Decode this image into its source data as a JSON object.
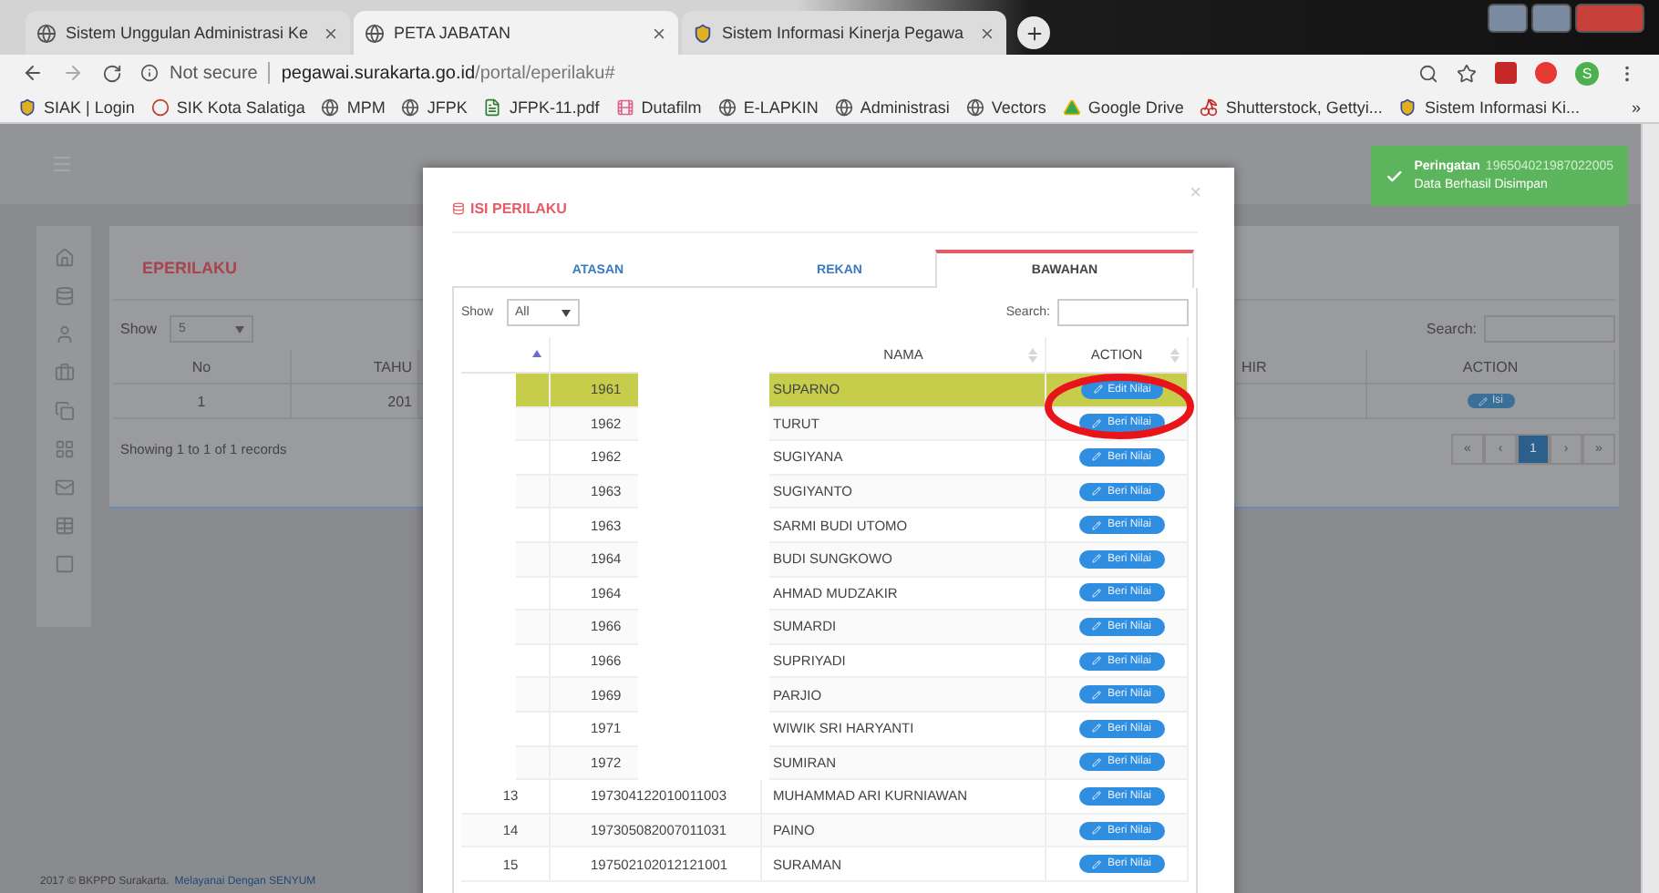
{
  "browser": {
    "tabs": [
      {
        "title": "Sistem Unggulan Administrasi Ke",
        "kind": "globe",
        "selected": false
      },
      {
        "title": "PETA JABATAN",
        "kind": "globe",
        "selected": true
      },
      {
        "title": "Sistem Informasi Kinerja Pegawa",
        "kind": "badge",
        "selected": false
      }
    ],
    "address": {
      "security": "Not secure",
      "host": "pegawai.surakarta.go.id",
      "path": "/portal/eperilaku#"
    },
    "profile_initial": "S",
    "bookmarks": [
      {
        "label": "SIAK | Login",
        "kind": "badge"
      },
      {
        "label": "SIK Kota Salatiga",
        "kind": "web"
      },
      {
        "label": "MPM",
        "kind": "globe"
      },
      {
        "label": "JFPK",
        "kind": "globe"
      },
      {
        "label": "JFPK-11.pdf",
        "kind": "doc"
      },
      {
        "label": "Dutafilm",
        "kind": "film"
      },
      {
        "label": "E-LAPKIN",
        "kind": "globe"
      },
      {
        "label": "Administrasi",
        "kind": "globe"
      },
      {
        "label": "Vectors",
        "kind": "globe"
      },
      {
        "label": "Google Drive",
        "kind": "drive"
      },
      {
        "label": "Shutterstock, Gettyi...",
        "kind": "fruit"
      },
      {
        "label": "Sistem Informasi Ki...",
        "kind": "badge"
      }
    ],
    "bookmarks_more": "»"
  },
  "page": {
    "card": {
      "title": "EPERILAKU",
      "show_label": "Show",
      "page_length": "5",
      "search_label": "Search:",
      "columns": [
        "No",
        "TAHU",
        "HIR",
        "ACTION"
      ],
      "rows": [
        {
          "no": "1",
          "tahun": "201",
          "action": "Isi"
        }
      ],
      "info": "Showing 1 to 1 of 1 records",
      "pagination": [
        {
          "label": "«",
          "selected": false
        },
        {
          "label": "‹",
          "selected": false
        },
        {
          "label": "1",
          "selected": true
        },
        {
          "label": "›",
          "selected": false
        },
        {
          "label": "»",
          "selected": false
        }
      ]
    },
    "footer": {
      "text": "2017 © BKPPD Surakarta.",
      "link": "Melayanai Dengan SENYUM"
    }
  },
  "toast": {
    "title": "Peringatan",
    "detail": "196504021987022005",
    "message": "Data Berhasil Disimpan"
  },
  "modal": {
    "title": "ISI PERILAKU",
    "close": "×",
    "tabs": [
      {
        "label": "ATASAN",
        "selected": false
      },
      {
        "label": "REKAN",
        "selected": false
      },
      {
        "label": "BAWAHAN",
        "selected": true
      }
    ],
    "show_label": "Show",
    "page_length": "All",
    "search_label": "Search:",
    "columns": [
      {
        "sorted": true
      },
      {
        "label": "NAMA",
        "sorted": false
      },
      {
        "label": "ACTION",
        "sorted": false
      }
    ],
    "rows": [
      {
        "nip": "1961",
        "name": "SUPARNO",
        "action": "Edit Nilai",
        "selected": true
      },
      {
        "nip": "1962",
        "name": "TURUT",
        "action": "Beri Nilai",
        "selected": false
      },
      {
        "nip": "1962",
        "name": "SUGIYANA",
        "action": "Beri Nilai",
        "selected": false
      },
      {
        "nip": "1963",
        "name": "SUGIYANTO",
        "action": "Beri Nilai",
        "selected": false
      },
      {
        "nip": "1963",
        "name": "SARMI BUDI UTOMO",
        "action": "Beri Nilai",
        "selected": false
      },
      {
        "nip": "1964",
        "name": "BUDI SUNGKOWO",
        "action": "Beri Nilai",
        "selected": false
      },
      {
        "nip": "1964",
        "name": "AHMAD MUDZAKIR",
        "action": "Beri Nilai",
        "selected": false
      },
      {
        "nip": "1966",
        "name": "SUMARDI",
        "action": "Beri Nilai",
        "selected": false
      },
      {
        "nip": "1966",
        "name": "SUPRIYADI",
        "action": "Beri Nilai",
        "selected": false
      },
      {
        "nip": "1969",
        "name": "PARJIO",
        "action": "Beri Nilai",
        "selected": false
      },
      {
        "nip": "1971",
        "name": "WIWIK SRI HARYANTI",
        "action": "Beri Nilai",
        "selected": false
      },
      {
        "nip": "1972",
        "name": "SUMIRAN",
        "action": "Beri Nilai",
        "selected": false
      },
      {
        "no": "13",
        "nip": "197304122010011003",
        "name": "MUHAMMAD ARI KURNIAWAN",
        "action": "Beri Nilai",
        "selected": false
      },
      {
        "no": "14",
        "nip": "197305082007011031",
        "name": "PAINO",
        "action": "Beri Nilai",
        "selected": false
      },
      {
        "no": "15",
        "nip": "197502102012121001",
        "name": "SURAMAN",
        "action": "Beri Nilai",
        "selected": false
      }
    ]
  }
}
